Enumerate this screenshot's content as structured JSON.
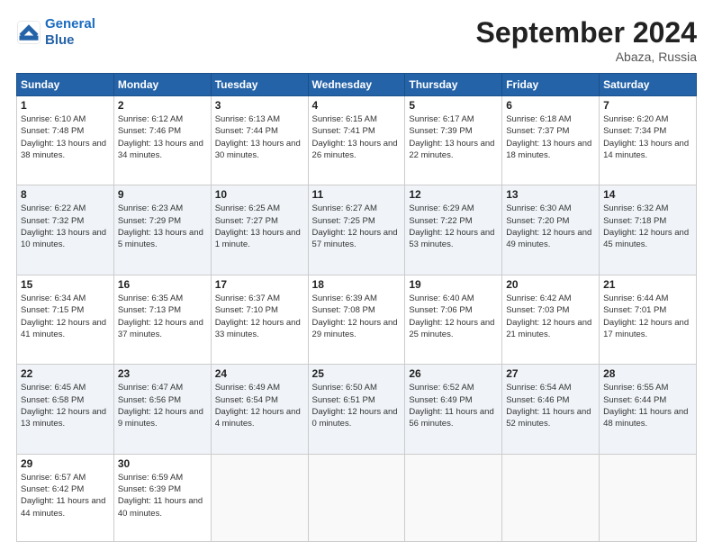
{
  "header": {
    "logo_line1": "General",
    "logo_line2": "Blue",
    "month": "September 2024",
    "location": "Abaza, Russia"
  },
  "days_of_week": [
    "Sunday",
    "Monday",
    "Tuesday",
    "Wednesday",
    "Thursday",
    "Friday",
    "Saturday"
  ],
  "weeks": [
    [
      {
        "day": "1",
        "sunrise": "Sunrise: 6:10 AM",
        "sunset": "Sunset: 7:48 PM",
        "daylight": "Daylight: 13 hours and 38 minutes."
      },
      {
        "day": "2",
        "sunrise": "Sunrise: 6:12 AM",
        "sunset": "Sunset: 7:46 PM",
        "daylight": "Daylight: 13 hours and 34 minutes."
      },
      {
        "day": "3",
        "sunrise": "Sunrise: 6:13 AM",
        "sunset": "Sunset: 7:44 PM",
        "daylight": "Daylight: 13 hours and 30 minutes."
      },
      {
        "day": "4",
        "sunrise": "Sunrise: 6:15 AM",
        "sunset": "Sunset: 7:41 PM",
        "daylight": "Daylight: 13 hours and 26 minutes."
      },
      {
        "day": "5",
        "sunrise": "Sunrise: 6:17 AM",
        "sunset": "Sunset: 7:39 PM",
        "daylight": "Daylight: 13 hours and 22 minutes."
      },
      {
        "day": "6",
        "sunrise": "Sunrise: 6:18 AM",
        "sunset": "Sunset: 7:37 PM",
        "daylight": "Daylight: 13 hours and 18 minutes."
      },
      {
        "day": "7",
        "sunrise": "Sunrise: 6:20 AM",
        "sunset": "Sunset: 7:34 PM",
        "daylight": "Daylight: 13 hours and 14 minutes."
      }
    ],
    [
      {
        "day": "8",
        "sunrise": "Sunrise: 6:22 AM",
        "sunset": "Sunset: 7:32 PM",
        "daylight": "Daylight: 13 hours and 10 minutes."
      },
      {
        "day": "9",
        "sunrise": "Sunrise: 6:23 AM",
        "sunset": "Sunset: 7:29 PM",
        "daylight": "Daylight: 13 hours and 5 minutes."
      },
      {
        "day": "10",
        "sunrise": "Sunrise: 6:25 AM",
        "sunset": "Sunset: 7:27 PM",
        "daylight": "Daylight: 13 hours and 1 minute."
      },
      {
        "day": "11",
        "sunrise": "Sunrise: 6:27 AM",
        "sunset": "Sunset: 7:25 PM",
        "daylight": "Daylight: 12 hours and 57 minutes."
      },
      {
        "day": "12",
        "sunrise": "Sunrise: 6:29 AM",
        "sunset": "Sunset: 7:22 PM",
        "daylight": "Daylight: 12 hours and 53 minutes."
      },
      {
        "day": "13",
        "sunrise": "Sunrise: 6:30 AM",
        "sunset": "Sunset: 7:20 PM",
        "daylight": "Daylight: 12 hours and 49 minutes."
      },
      {
        "day": "14",
        "sunrise": "Sunrise: 6:32 AM",
        "sunset": "Sunset: 7:18 PM",
        "daylight": "Daylight: 12 hours and 45 minutes."
      }
    ],
    [
      {
        "day": "15",
        "sunrise": "Sunrise: 6:34 AM",
        "sunset": "Sunset: 7:15 PM",
        "daylight": "Daylight: 12 hours and 41 minutes."
      },
      {
        "day": "16",
        "sunrise": "Sunrise: 6:35 AM",
        "sunset": "Sunset: 7:13 PM",
        "daylight": "Daylight: 12 hours and 37 minutes."
      },
      {
        "day": "17",
        "sunrise": "Sunrise: 6:37 AM",
        "sunset": "Sunset: 7:10 PM",
        "daylight": "Daylight: 12 hours and 33 minutes."
      },
      {
        "day": "18",
        "sunrise": "Sunrise: 6:39 AM",
        "sunset": "Sunset: 7:08 PM",
        "daylight": "Daylight: 12 hours and 29 minutes."
      },
      {
        "day": "19",
        "sunrise": "Sunrise: 6:40 AM",
        "sunset": "Sunset: 7:06 PM",
        "daylight": "Daylight: 12 hours and 25 minutes."
      },
      {
        "day": "20",
        "sunrise": "Sunrise: 6:42 AM",
        "sunset": "Sunset: 7:03 PM",
        "daylight": "Daylight: 12 hours and 21 minutes."
      },
      {
        "day": "21",
        "sunrise": "Sunrise: 6:44 AM",
        "sunset": "Sunset: 7:01 PM",
        "daylight": "Daylight: 12 hours and 17 minutes."
      }
    ],
    [
      {
        "day": "22",
        "sunrise": "Sunrise: 6:45 AM",
        "sunset": "Sunset: 6:58 PM",
        "daylight": "Daylight: 12 hours and 13 minutes."
      },
      {
        "day": "23",
        "sunrise": "Sunrise: 6:47 AM",
        "sunset": "Sunset: 6:56 PM",
        "daylight": "Daylight: 12 hours and 9 minutes."
      },
      {
        "day": "24",
        "sunrise": "Sunrise: 6:49 AM",
        "sunset": "Sunset: 6:54 PM",
        "daylight": "Daylight: 12 hours and 4 minutes."
      },
      {
        "day": "25",
        "sunrise": "Sunrise: 6:50 AM",
        "sunset": "Sunset: 6:51 PM",
        "daylight": "Daylight: 12 hours and 0 minutes."
      },
      {
        "day": "26",
        "sunrise": "Sunrise: 6:52 AM",
        "sunset": "Sunset: 6:49 PM",
        "daylight": "Daylight: 11 hours and 56 minutes."
      },
      {
        "day": "27",
        "sunrise": "Sunrise: 6:54 AM",
        "sunset": "Sunset: 6:46 PM",
        "daylight": "Daylight: 11 hours and 52 minutes."
      },
      {
        "day": "28",
        "sunrise": "Sunrise: 6:55 AM",
        "sunset": "Sunset: 6:44 PM",
        "daylight": "Daylight: 11 hours and 48 minutes."
      }
    ],
    [
      {
        "day": "29",
        "sunrise": "Sunrise: 6:57 AM",
        "sunset": "Sunset: 6:42 PM",
        "daylight": "Daylight: 11 hours and 44 minutes."
      },
      {
        "day": "30",
        "sunrise": "Sunrise: 6:59 AM",
        "sunset": "Sunset: 6:39 PM",
        "daylight": "Daylight: 11 hours and 40 minutes."
      },
      null,
      null,
      null,
      null,
      null
    ]
  ]
}
